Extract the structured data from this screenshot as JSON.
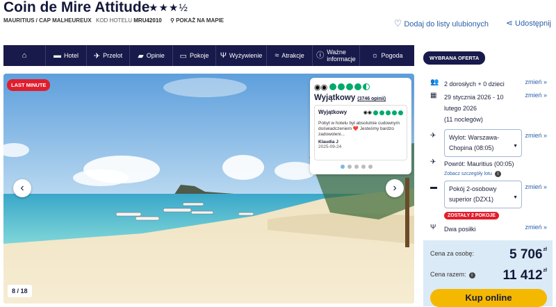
{
  "hotel": {
    "name": "Coin de Mire Attitude",
    "stars": "★★★½",
    "location": "MAURITIUS / CAP MALHEUREUX",
    "code_label": "KOD HOTELU",
    "code": "MRU42010",
    "map_label": "POKAŻ NA MAPIE"
  },
  "actions": {
    "favorite": "Dodaj do listy ulubionych",
    "share": "Udostępnij"
  },
  "nav": [
    {
      "label": "",
      "icon": "home-icon",
      "glyph": "⌂"
    },
    {
      "label": "Hotel",
      "icon": "bed-icon",
      "glyph": "▬"
    },
    {
      "label": "Przelot",
      "icon": "plane-icon",
      "glyph": "✈"
    },
    {
      "label": "Opinie",
      "icon": "chat-icon",
      "glyph": "▰"
    },
    {
      "label": "Pokoje",
      "icon": "room-icon",
      "glyph": "▭"
    },
    {
      "label": "Wyżywienie",
      "icon": "cutlery-icon",
      "glyph": "Ψ"
    },
    {
      "label": "Atrakcje",
      "icon": "swim-icon",
      "glyph": "≈"
    },
    {
      "label": "Ważne informacje",
      "icon": "info-icon",
      "glyph": "ⓘ"
    },
    {
      "label": "Pogoda",
      "icon": "sun-icon",
      "glyph": "☼"
    }
  ],
  "gallery": {
    "badge": "LAST MINUTE",
    "counter": "8 / 18",
    "prev": "‹",
    "next": "›"
  },
  "tripadvisor": {
    "rating_bubbles": 4.5,
    "rating_label": "Wyjątkowy",
    "reviews_count": "(3746 opinii)",
    "review": {
      "title": "Wyjątkowy",
      "text": "Pobyt w hotelu był absolutnie cudownym doświadczeniem ❤️ Jesteśmy bardzo zadowoleni...",
      "author": "Klaudia J",
      "date": "2025-09-24",
      "bubbles": 5
    },
    "pager_count": 5,
    "pager_active": 0
  },
  "offer": {
    "title": "WYBRANA OFERTA",
    "change": "zmień »",
    "guests": "2 dorosłych + 0 dzieci",
    "dates_line1": "29 stycznia 2026 - 10",
    "dates_line2": "lutego 2026",
    "nights": "(11 noclegów)",
    "departure_line1": "Wylot: Warszawa-",
    "departure_line2": "Chopina (08:05)",
    "return": "Powrót: Mauritius (00:05)",
    "flight_details": "Zobacz szczegóły lotu",
    "room_line1": "Pokój 2-osobowy",
    "room_line2": "superior (DZX1)",
    "rooms_left": "ZOSTAŁY 2 POKOJE",
    "board": "Dwa posiłki"
  },
  "price": {
    "per_person_label": "Cena za osobę:",
    "per_person": "5 706",
    "total_label": "Cena razem:",
    "total": "11 412",
    "currency": "zł",
    "buy": "Kup online"
  },
  "colors": {
    "navy": "#171a4a",
    "accent_red": "#e01e2d",
    "link_blue": "#2a5fa8",
    "buy_yellow": "#f5b800",
    "ta_green": "#00aa6c",
    "price_bg": "#dbeaf7"
  }
}
